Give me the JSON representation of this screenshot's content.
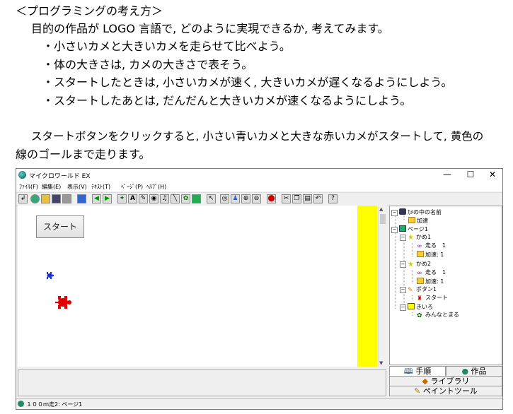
{
  "document": {
    "heading": "＜プログラミングの考え方＞",
    "intro": "目的の作品が LOGO 言語で, どのように実現できるか, 考えてみます。",
    "bullets": [
      "・小さいカメと大きいカメを走らせて比べよう。",
      "・体の大きさは, カメの大きさで表そう。",
      "・スタートしたときは, 小さいカメが速く, 大きいカメが遅くなるようにしよう。",
      "・スタートしたあとは, だんだんと大きいカメが速くなるようにしよう。"
    ],
    "paragraph_line1": "スタートボタンをクリックすると, 小さい青いカメと大きな赤いカメがスタートして, 黄色の",
    "paragraph_line2": "線のゴールまで走ります。"
  },
  "window": {
    "title": "マイクロワールド EX",
    "controls": [
      "—",
      "☐",
      "✕"
    ]
  },
  "menu": [
    "ﾌｧｲﾙ(F)",
    "編集(E)",
    "表示(V)",
    "ﾃｷｽﾄ(T)",
    "ﾍﾟｰｼﾞ(P)",
    "ﾍﾙﾌﾟ(H)"
  ],
  "canvas": {
    "start_button": "スタート",
    "goal_color": "#ffff00",
    "small_turtle_color": "#1a2fd8",
    "big_turtle_color": "#e00000"
  },
  "tree": {
    "nodes": [
      {
        "label": "ｶﾒの中の名前",
        "icon": "turtle-names-icon"
      },
      {
        "label": "加速",
        "icon": "procedure-icon"
      },
      {
        "label": "ページ1",
        "icon": "page-icon"
      },
      {
        "label": "かめ1",
        "icon": "turtle-icon"
      },
      {
        "label": "走る　1",
        "icon": "loop-icon"
      },
      {
        "label": "加速: 1",
        "icon": "procedure-icon"
      },
      {
        "label": "かめ2",
        "icon": "turtle-icon"
      },
      {
        "label": "走る　1",
        "icon": "loop-icon"
      },
      {
        "label": "加速: 1",
        "icon": "procedure-icon"
      },
      {
        "label": "ボタン1",
        "icon": "button-icon"
      },
      {
        "label": "スタート",
        "icon": "start-icon"
      },
      {
        "label": "きいろ",
        "icon": "color-icon"
      },
      {
        "label": "みんなとまる",
        "icon": "stop-icon"
      }
    ]
  },
  "tabs": {
    "procedure": "手順",
    "project": "作品",
    "library": "ライブラリ",
    "paint": "ペイントツール"
  },
  "status": "１００ｍ走2: ページ1"
}
